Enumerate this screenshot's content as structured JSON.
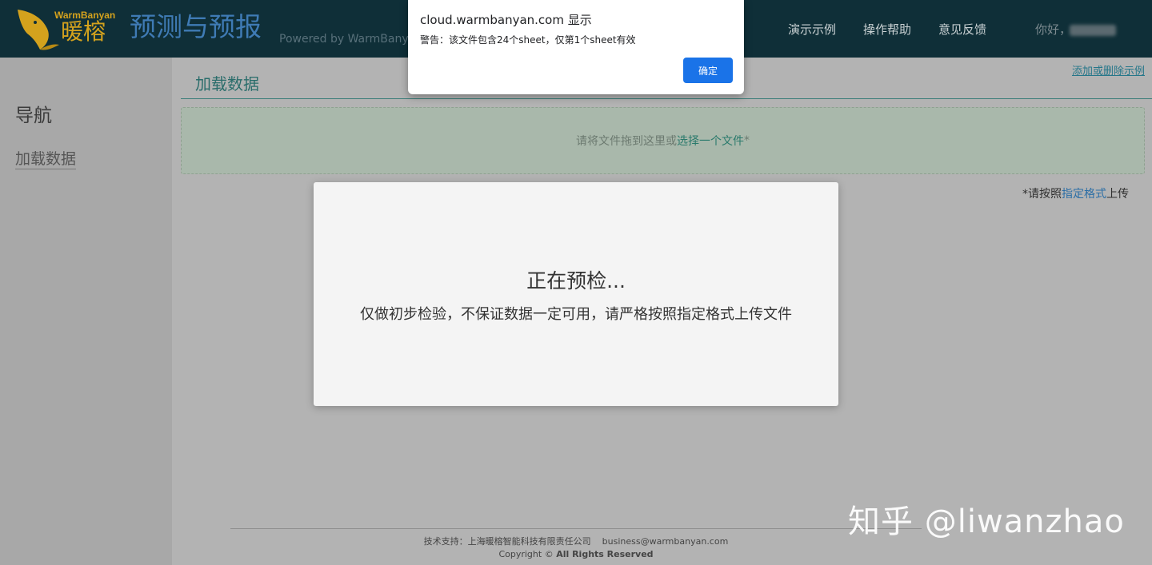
{
  "header": {
    "logo_en": "WarmBanyan",
    "logo_cn": "暖榕",
    "logo_icon": "bird-logo-icon",
    "title": "预测与预报",
    "powered_by": "Powered by WarmBanyan",
    "nav": [
      {
        "label": "演示示例"
      },
      {
        "label": "操作帮助"
      },
      {
        "label": "意见反馈"
      }
    ],
    "greeting": "你好，"
  },
  "sidebar": {
    "title": "导航",
    "items": [
      {
        "label": "加载数据"
      }
    ]
  },
  "main": {
    "heading": "加载数据",
    "manage_examples_link": "添加或删除示例",
    "dropzone": {
      "prefix": "请将文件拖到这里或",
      "choose_link": "选择一个文件",
      "suffix": "*"
    },
    "format_note": {
      "prefix": "*请按照",
      "link": "指定格式",
      "suffix": "上传"
    }
  },
  "precheck_modal": {
    "title": "正在预检...",
    "message": "仅做初步检验，不保证数据一定可用，请严格按照指定格式上传文件"
  },
  "browser_alert": {
    "origin": "cloud.warmbanyan.com 显示",
    "message": "警告：该文件包含24个sheet，仅第1个sheet有效",
    "ok_label": "确定"
  },
  "footer": {
    "support": "技术支持：上海暖榕智能科技有限责任公司",
    "email": "business@warmbanyan.com",
    "copyright": "Copyright ©",
    "rights": "All Rights Reserved"
  },
  "watermark": "知乎 @liwanzhao",
  "colors": {
    "header_bg": "#0f2f38",
    "brand_gold": "#d4a21d",
    "title_blue": "#3f7bb5",
    "accent_teal": "#2a6d6b",
    "alert_button": "#1a73e8"
  }
}
